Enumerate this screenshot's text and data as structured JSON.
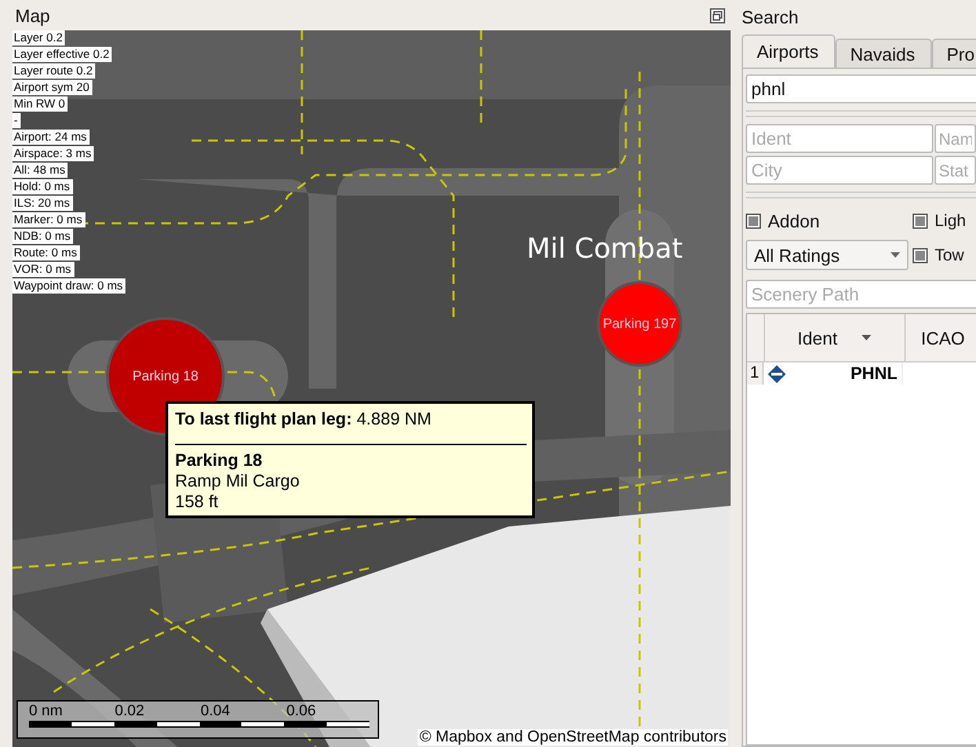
{
  "map": {
    "title": "Map",
    "debug_lines": [
      "Layer 0.2",
      "Layer effective 0.2",
      "Layer route 0.2",
      "Airport sym 20",
      "Min RW 0",
      "-",
      "Airport: 24 ms",
      "Airspace: 3 ms",
      "All: 48 ms",
      "Hold: 0 ms",
      "ILS: 20 ms",
      "Marker: 0 ms",
      "NDB: 0 ms",
      "Route: 0 ms",
      "VOR: 0 ms",
      "Waypoint draw: 0 ms"
    ],
    "area_label": "Mil Combat",
    "parkings": [
      {
        "label": "Parking 18",
        "color": "#c00000"
      },
      {
        "label": "Parking 197",
        "color": "#ff0000"
      }
    ],
    "tooltip": {
      "distance_label": "To last flight plan leg:",
      "distance": "4.889 NM",
      "name": "Parking 18",
      "type": "Ramp Mil Cargo",
      "elevation": "158 ft"
    },
    "scale": {
      "ticks": [
        "0 nm",
        "0.02",
        "0.04",
        "0.06"
      ]
    },
    "attribution": "© Mapbox and OpenStreetMap contributors"
  },
  "search": {
    "title": "Search",
    "tabs": [
      {
        "label": "Airports",
        "selected": true
      },
      {
        "label": "Navaids",
        "selected": false
      },
      {
        "label": "Pro",
        "selected": false
      }
    ],
    "query": "phnl",
    "fields": [
      {
        "placeholder": "Ident"
      },
      {
        "placeholder": "Nam"
      },
      {
        "placeholder": "City"
      },
      {
        "placeholder": "Stat"
      }
    ],
    "checkboxes": [
      {
        "label": "Addon",
        "partial": true
      },
      {
        "label": "Ligh",
        "partial": true
      },
      {
        "label": "Tow",
        "partial": true
      }
    ],
    "rating": "All Ratings",
    "scenery_placeholder": "Scenery Path",
    "columns": [
      "Ident",
      "ICAO"
    ],
    "rows": [
      {
        "number": "1",
        "ident": "PHNL"
      }
    ]
  }
}
